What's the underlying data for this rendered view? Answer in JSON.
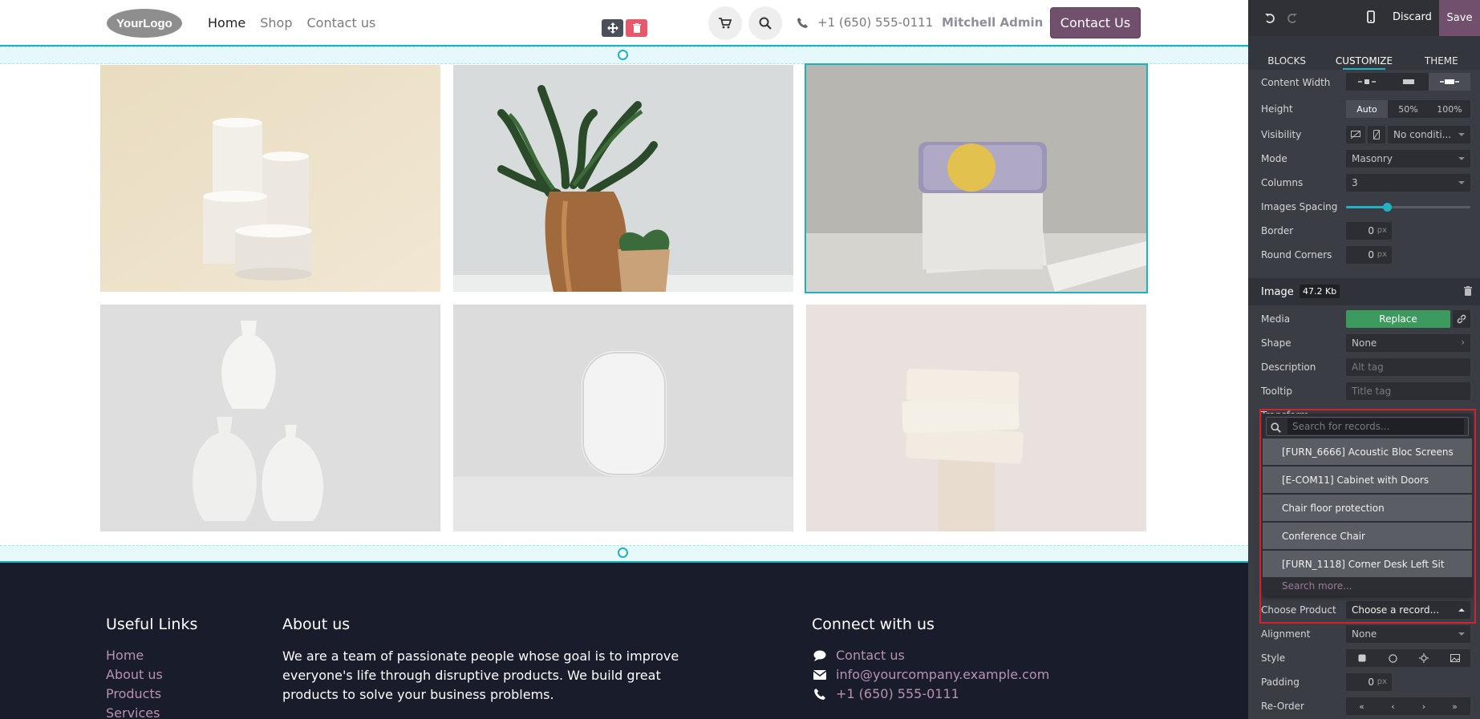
{
  "header": {
    "logo_text": "YourLogo",
    "nav": [
      "Home",
      "Shop",
      "Contact us"
    ],
    "phone": "+1 (650) 555-0111",
    "user": "Mitchell Admin",
    "contact_button": "Contact Us"
  },
  "gallery": {
    "images": [
      {
        "subject": "white cylinders on beige",
        "selected": false
      },
      {
        "subject": "plant in wooden vase",
        "selected": false
      },
      {
        "subject": "fabric speaker on white block",
        "selected": true
      },
      {
        "subject": "stacked white vases",
        "selected": false
      },
      {
        "subject": "white smart speaker",
        "selected": false
      },
      {
        "subject": "stacked soap bars",
        "selected": false
      }
    ]
  },
  "footer": {
    "useful_links_title": "Useful Links",
    "useful_links": [
      "Home",
      "About us",
      "Products",
      "Services"
    ],
    "about_title": "About us",
    "about_text": "We are a team of passionate people whose goal is to improve everyone's life through disruptive products. We build great products to solve your business problems.",
    "connect_title": "Connect with us",
    "connect": [
      "Contact us",
      "info@yourcompany.example.com",
      "+1 (650) 555-0111"
    ]
  },
  "panel": {
    "discard": "Discard",
    "save": "Save",
    "tabs": [
      "BLOCKS",
      "CUSTOMIZE",
      "THEME"
    ],
    "active_tab": "CUSTOMIZE",
    "content_width_label": "Content Width",
    "height_label": "Height",
    "height_options": [
      "Auto",
      "50%",
      "100%"
    ],
    "visibility_label": "Visibility",
    "visibility_value": "No conditi...",
    "mode_label": "Mode",
    "mode_value": "Masonry",
    "columns_label": "Columns",
    "columns_value": "3",
    "spacing_label": "Images Spacing",
    "spacing_level": 0.33,
    "border_label": "Border",
    "border_value": "0",
    "round_label": "Round Corners",
    "round_value": "0",
    "unit": "px",
    "image_section": "Image",
    "image_size": "47.2 Kb",
    "media_label": "Media",
    "replace": "Replace",
    "shape_label": "Shape",
    "shape_value": "None",
    "description_label": "Description",
    "description_placeholder": "Alt tag",
    "tooltip_label": "Tooltip",
    "tooltip_placeholder": "Title tag",
    "transform_label": "Transform",
    "choose_product_label": "Choose Product",
    "choose_product_value": "Choose a record...",
    "alignment_label": "Alignment",
    "alignment_value": "None",
    "style_label": "Style",
    "padding_label": "Padding",
    "padding_value": "0",
    "reorder_label": "Re-Order"
  },
  "dropdown": {
    "search_placeholder": "Search for records...",
    "items": [
      "[FURN_6666] Acoustic Bloc Screens",
      "[E-COM11] Cabinet with Doors",
      "Chair floor protection",
      "Conference Chair",
      "[FURN_1118] Corner Desk Left Sit"
    ],
    "search_more": "Search more..."
  },
  "colors": {
    "brand": "#71506d",
    "selection": "#17b5c2",
    "footer_bg": "#191c2a",
    "panel_bg": "#3a3d44",
    "replace_green": "#3d9a5f",
    "highlight_red": "#d3222c"
  }
}
